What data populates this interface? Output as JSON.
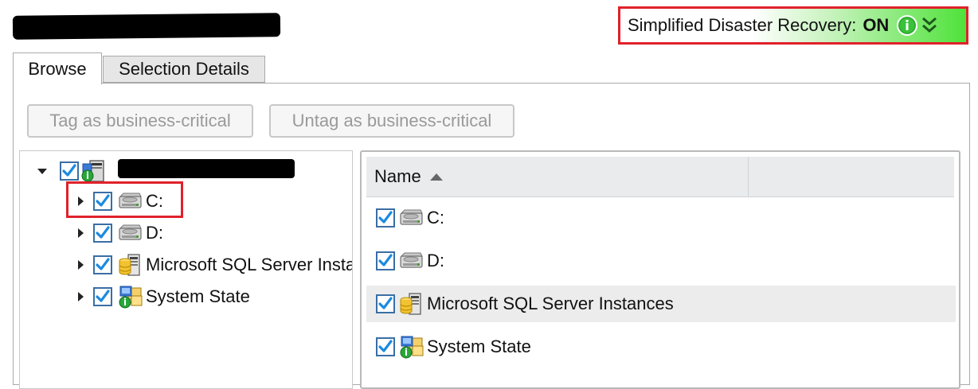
{
  "sdr": {
    "label": "Simplified Disaster Recovery:",
    "value": "ON",
    "accent_color": "#4fe23a",
    "highlight_color": "#e0212b"
  },
  "tabs": [
    {
      "label": "Browse",
      "active": true
    },
    {
      "label": "Selection Details",
      "active": false
    }
  ],
  "toolbar": {
    "tag_label": "Tag as business-critical",
    "untag_label": "Untag as business-critical"
  },
  "tree": {
    "items": [
      {
        "label": "C:",
        "icon": "drive-icon",
        "checked": true
      },
      {
        "label": "D:",
        "icon": "drive-icon",
        "checked": true
      },
      {
        "label": "Microsoft SQL Server Instances",
        "icon": "sql-server-icon",
        "checked": true
      },
      {
        "label": "System State",
        "icon": "system-state-icon",
        "checked": true
      }
    ]
  },
  "list": {
    "column_name": "Name",
    "rows": [
      {
        "label": "C:",
        "icon": "drive-icon",
        "checked": true
      },
      {
        "label": "D:",
        "icon": "drive-icon",
        "checked": true
      },
      {
        "label": "Microsoft SQL Server Instances",
        "icon": "sql-server-icon",
        "checked": true,
        "selected": true
      },
      {
        "label": "System State",
        "icon": "system-state-icon",
        "checked": true
      }
    ]
  }
}
